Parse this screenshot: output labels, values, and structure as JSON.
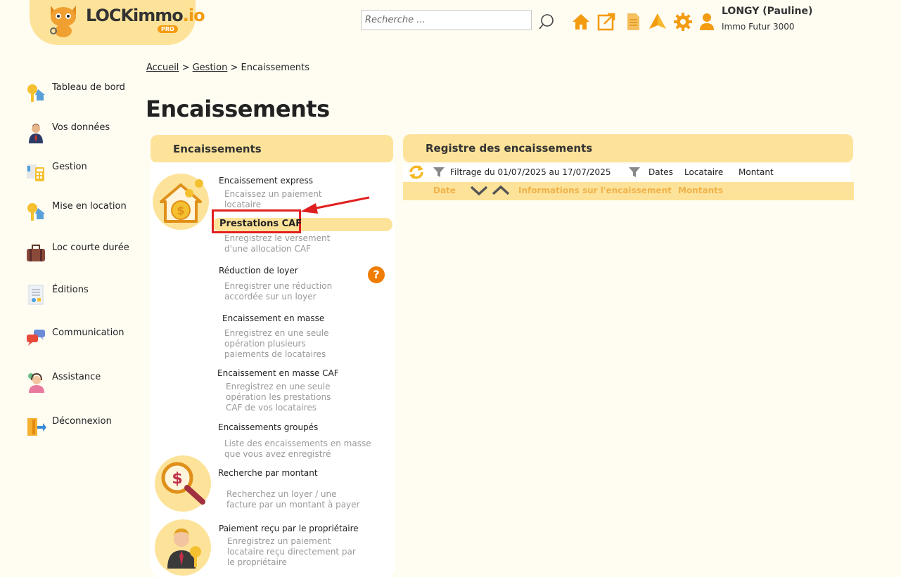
{
  "header": {
    "logo_text": "LOCKimmo",
    "logo_suffix": ".io",
    "logo_badge": "PRO",
    "search_placeholder": "Recherche ...",
    "icons": [
      "search-icon",
      "home-icon",
      "external-link-icon",
      "document-icon",
      "alert-icon",
      "gear-icon",
      "user-icon"
    ],
    "user_name": "LONGY (Pauline)",
    "user_company": "Immo Futur 3000"
  },
  "sidebar": {
    "items": [
      {
        "label": "Tableau de bord",
        "icon": "keys-house-icon"
      },
      {
        "label": "Vos données",
        "icon": "person-icon"
      },
      {
        "label": "Gestion",
        "icon": "calculator-icon"
      },
      {
        "label": "Mise en location",
        "icon": "keys-house-icon"
      },
      {
        "label": "Loc courte durée",
        "icon": "suitcase-icon"
      },
      {
        "label": "Éditions",
        "icon": "report-icon"
      },
      {
        "label": "Communication",
        "icon": "chat-bubbles-icon"
      },
      {
        "label": "Assistance",
        "icon": "support-agent-icon"
      },
      {
        "label": "Déconnexion",
        "icon": "logout-door-icon"
      }
    ]
  },
  "breadcrumb": {
    "home": "Accueil",
    "section": "Gestion",
    "current": "Encaissements",
    "sep": ">"
  },
  "page_title": "Encaissements",
  "left_panel": {
    "title": "Encaissements",
    "items": [
      {
        "title": "Encaissement express",
        "desc": [
          "Encaissez un paiement",
          "locataire"
        ]
      },
      {
        "title": "Prestations CAF",
        "desc": [
          "Enregistrez le versement",
          "d'une allocation CAF"
        ]
      },
      {
        "title": "Réduction de loyer",
        "desc": [
          "Enregistrer une réduction",
          "accordée sur un loyer"
        ]
      },
      {
        "title": "Encaissement en masse",
        "desc": [
          "Enregistrez en une seule",
          "opération plusieurs",
          "paiements de locataires"
        ]
      },
      {
        "title": "Encaissement en masse CAF",
        "desc": [
          "Enregistrez en une seule",
          "opération les prestations",
          "CAF de vos locataires"
        ]
      },
      {
        "title": "Encaissements groupés",
        "desc": [
          "Liste des encaissements en masse",
          "que vous avez enregistré"
        ]
      },
      {
        "title": "Recherche par montant",
        "desc": [
          "Recherchez un loyer / une",
          "facture par un montant à payer"
        ]
      },
      {
        "title": "Paiement reçu par le propriétaire",
        "desc": [
          "Enregistrez un paiement",
          "locataire reçu directement par",
          "le propriétaire"
        ]
      }
    ],
    "help": "?"
  },
  "right_panel": {
    "title": "Registre des encaissements",
    "filter_label": "Filtrage du 01/07/2025 au 17/07/2025",
    "filter_options": [
      "Dates",
      "Locataire",
      "Montant"
    ],
    "columns": [
      "Date",
      "Informations sur l'encaissement",
      "Montants"
    ]
  },
  "colors": {
    "accent": "#fde39a",
    "orange": "#f39c12",
    "highlight_border": "#e02020",
    "background": "#fffcf2"
  }
}
